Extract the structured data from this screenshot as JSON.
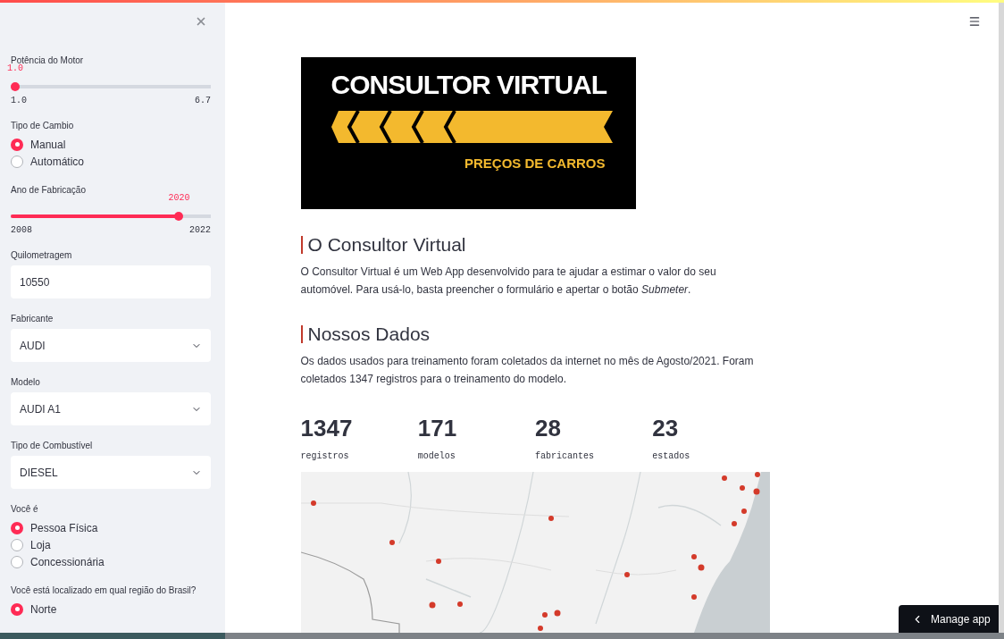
{
  "sidebar": {
    "widgets": [
      {
        "kind": "slider",
        "label": "Potência do Motor",
        "value": "1.0",
        "min": "1.0",
        "max": "6.7",
        "level": 0
      },
      {
        "kind": "radio",
        "label": "Tipo de Cambio",
        "options": [
          {
            "label": "Manual",
            "selected": true
          },
          {
            "label": "Automático",
            "selected": false
          }
        ]
      },
      {
        "kind": "slider",
        "label": "Ano de Fabricação",
        "value": "2020",
        "min": "2008",
        "max": "2022",
        "level": 0.857
      },
      {
        "kind": "number",
        "label": "Quilometragem",
        "value": "10550"
      },
      {
        "kind": "select",
        "label": "Fabricante",
        "value": "AUDI"
      },
      {
        "kind": "select",
        "label": "Modelo",
        "value": "AUDI A1"
      },
      {
        "kind": "select",
        "label": "Tipo de Combustível",
        "value": "DIESEL"
      },
      {
        "kind": "radio",
        "label": "Você é",
        "options": [
          {
            "label": "Pessoa Física",
            "selected": true
          },
          {
            "label": "Loja",
            "selected": false
          },
          {
            "label": "Concessionária",
            "selected": false
          }
        ]
      },
      {
        "kind": "radio",
        "label": "Você está localizado em qual região do Brasil?",
        "options": [
          {
            "label": "Norte",
            "selected": true
          }
        ]
      }
    ]
  },
  "banner": {
    "title": "CONSULTOR VIRTUAL",
    "subtitle": "PREÇOS DE CARROS"
  },
  "sections": [
    {
      "heading": "O Consultor Virtual",
      "text": "O Consultor Virtual é um Web App desenvolvido para te ajudar a estimar o valor do seu automóvel. Para usá-lo, basta preencher o formulário e apertar o botão *Submeter*."
    },
    {
      "heading": "Nossos Dados",
      "text": "Os dados usados para treinamento foram coletados da internet no mês de Agosto/2021. Foram coletados 1347 registros para o treinamento do modelo."
    }
  ],
  "metrics": [
    {
      "value": "1347",
      "label": "registros"
    },
    {
      "value": "171",
      "label": "modelos"
    },
    {
      "value": "28",
      "label": "fabricantes"
    },
    {
      "value": "23",
      "label": "estados"
    }
  ],
  "manage_button": "Manage app"
}
